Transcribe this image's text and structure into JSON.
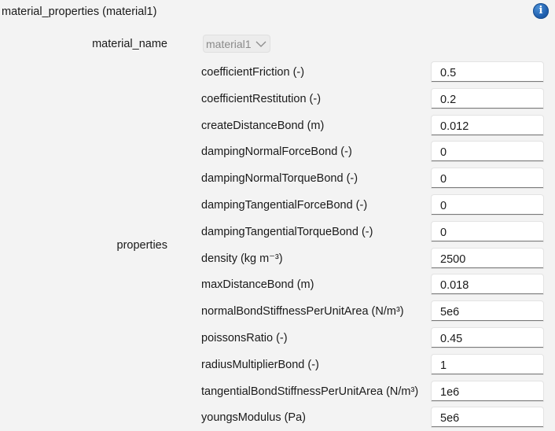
{
  "header": {
    "title": "material_properties (material1)",
    "info_icon": "info-icon",
    "info_color": "#1f5fae"
  },
  "material_name": {
    "label": "material_name",
    "selected": "material1"
  },
  "properties": {
    "label": "properties",
    "rows": [
      {
        "name": "coefficientFriction (-)",
        "value": "0.5"
      },
      {
        "name": "coefficientRestitution (-)",
        "value": "0.2"
      },
      {
        "name": "createDistanceBond (m)",
        "value": "0.012"
      },
      {
        "name": "dampingNormalForceBond (-)",
        "value": "0"
      },
      {
        "name": "dampingNormalTorqueBond (-)",
        "value": "0"
      },
      {
        "name": "dampingTangentialForceBond (-)",
        "value": "0"
      },
      {
        "name": "dampingTangentialTorqueBond (-)",
        "value": "0"
      },
      {
        "name": "density (kg m⁻³)",
        "value": "2500"
      },
      {
        "name": "maxDistanceBond (m)",
        "value": "0.018"
      },
      {
        "name": "normalBondStiffnessPerUnitArea (N/m³)",
        "value": "5e6"
      },
      {
        "name": "poissonsRatio (-)",
        "value": "0.45"
      },
      {
        "name": "radiusMultiplierBond (-)",
        "value": "1"
      },
      {
        "name": "tangentialBondStiffnessPerUnitArea (N/m³)",
        "value": "1e6"
      },
      {
        "name": "youngsModulus (Pa)",
        "value": "5e6"
      }
    ]
  }
}
